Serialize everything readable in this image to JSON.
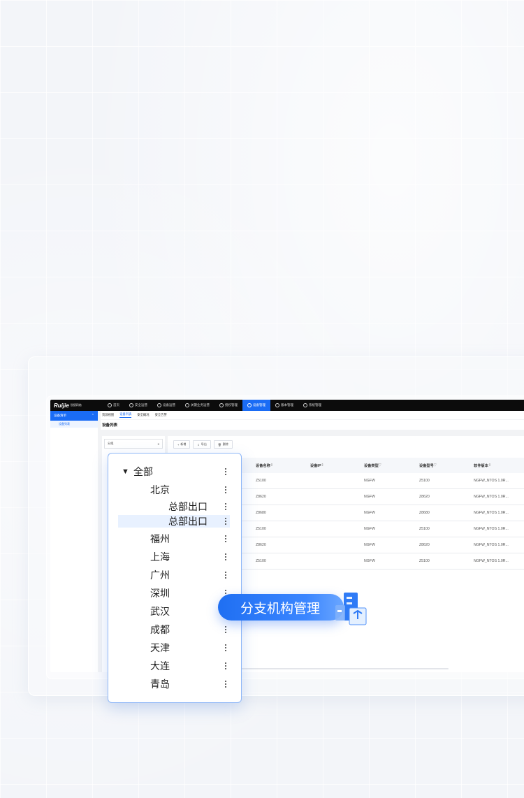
{
  "app": {
    "logo": "Ruijie",
    "logo_sub": "锐捷网络",
    "nav": [
      "首页",
      "安全运营",
      "设备运营",
      "关键业务运营",
      "授权管理",
      "设备管理",
      "版本管理",
      "系统管理"
    ],
    "nav_active_index": 5,
    "sidebar": {
      "header": "设备清单",
      "items": [
        "设备列表"
      ]
    },
    "subtabs": [
      "资源视图",
      "设备列表",
      "安全概况",
      "安全告警"
    ],
    "subtab_active_index": 1,
    "page_title": "设备列表",
    "group_selector": "分组",
    "toolbar": {
      "add": "新增",
      "import": "导出",
      "delete": "删除"
    },
    "table": {
      "columns": [
        "设备名称",
        "设备IP",
        "设备类型",
        "设备型号",
        "软件版本"
      ],
      "rows": [
        [
          "Z5100",
          "",
          "NGFW",
          "Z5100",
          "NGFW_NTOS 1.0R..."
        ],
        [
          "Z8620",
          "",
          "NGFW",
          "Z8620",
          "NGFW_NTOS 1.0R..."
        ],
        [
          "Z8680",
          "",
          "NGFW",
          "Z8680",
          "NGFW_NTOS 1.0R..."
        ],
        [
          "Z5100",
          "",
          "NGFW",
          "Z5100",
          "NGFW_NTOS 1.0R..."
        ],
        [
          "Z8620",
          "",
          "NGFW",
          "Z8620",
          "NGFW_NTOS 1.0R..."
        ],
        [
          "Z5100",
          "",
          "NGFW",
          "Z5100",
          "NGFW_NTOS 1.0R..."
        ]
      ]
    }
  },
  "tree": {
    "nodes": [
      {
        "label": "全部",
        "level": 0,
        "caret": "▼"
      },
      {
        "label": "北京",
        "level": 1
      },
      {
        "label": "总部出口",
        "level": 2
      },
      {
        "label": "总部出口",
        "level": 2,
        "selected": true
      },
      {
        "label": "福州",
        "level": 1
      },
      {
        "label": "上海",
        "level": 1
      },
      {
        "label": "广州",
        "level": 1
      },
      {
        "label": "深圳",
        "level": 1
      },
      {
        "label": "武汉",
        "level": 1
      },
      {
        "label": "成都",
        "level": 1
      },
      {
        "label": "天津",
        "level": 1
      },
      {
        "label": "大连",
        "level": 1
      },
      {
        "label": "青岛",
        "level": 1
      }
    ]
  },
  "badge": {
    "label": "分支机构管理"
  },
  "colors": {
    "accent": "#1a6cf5",
    "topbar": "#0c0c0c",
    "selected_row": "#e8f1ff"
  },
  "icons": {
    "nav": "circle-icon",
    "add": "plus-icon",
    "export": "download-icon",
    "delete": "trash-icon",
    "kebab": "more-vertical-icon",
    "badge": "buildings-icon"
  }
}
